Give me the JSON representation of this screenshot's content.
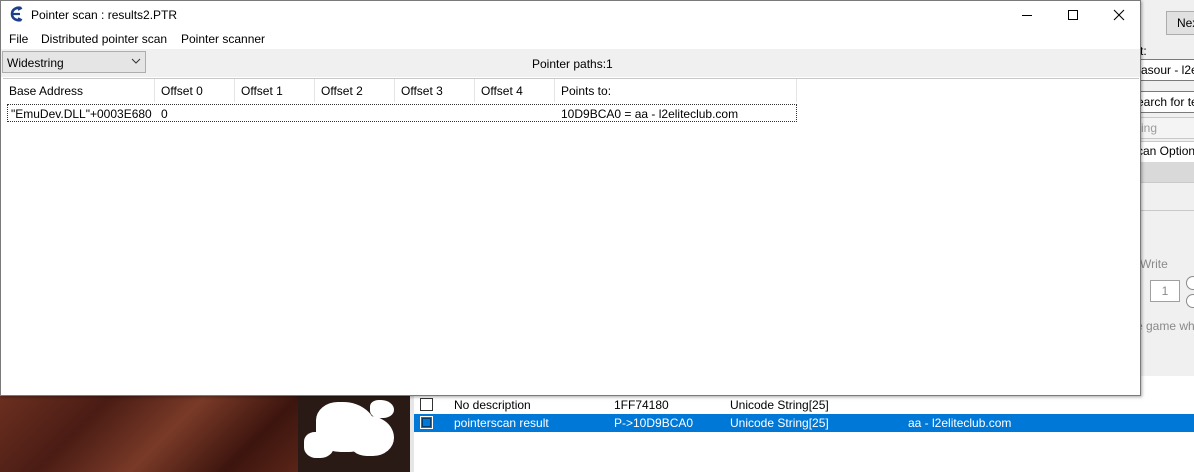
{
  "window": {
    "title": "Pointer scan : results2.PTR",
    "app_icon": "cheat-engine-icon",
    "caption_buttons": [
      "minimize-icon",
      "maximize-icon",
      "close-icon"
    ]
  },
  "menu": [
    "File",
    "Distributed pointer scan",
    "Pointer scanner"
  ],
  "toolbar": {
    "type_value": "Widestring",
    "pointer_paths": "Pointer paths:1"
  },
  "results": {
    "columns": [
      "Base Address",
      "Offset 0",
      "Offset 1",
      "Offset 2",
      "Offset 3",
      "Offset 4",
      "Points to:"
    ],
    "rows": [
      {
        "base_address": "\"EmuDev.DLL\"+0003E680",
        "offset0": "0",
        "points_to": "10D9BCA0 = aa - l2eliteclub.com"
      }
    ]
  },
  "background_window": {
    "next_button": "Nex",
    "label_fragment": "t:",
    "process_fragment": "asour - l2e",
    "search_fragment": "earch for te",
    "string_fragment": "ring",
    "options_fragment": "can Option",
    "write_fragment": "Write",
    "spin_value": "1",
    "game_fragment": "e game wh"
  },
  "address_list": {
    "rows": [
      {
        "description": "No description",
        "address": "1FF74180",
        "type": "Unicode String[25]",
        "value": "",
        "selected": false
      },
      {
        "description": "pointerscan result",
        "address": "P->10D9BCA0",
        "type": "Unicode String[25]",
        "value": "aa - l2eliteclub.com",
        "selected": true
      }
    ]
  }
}
